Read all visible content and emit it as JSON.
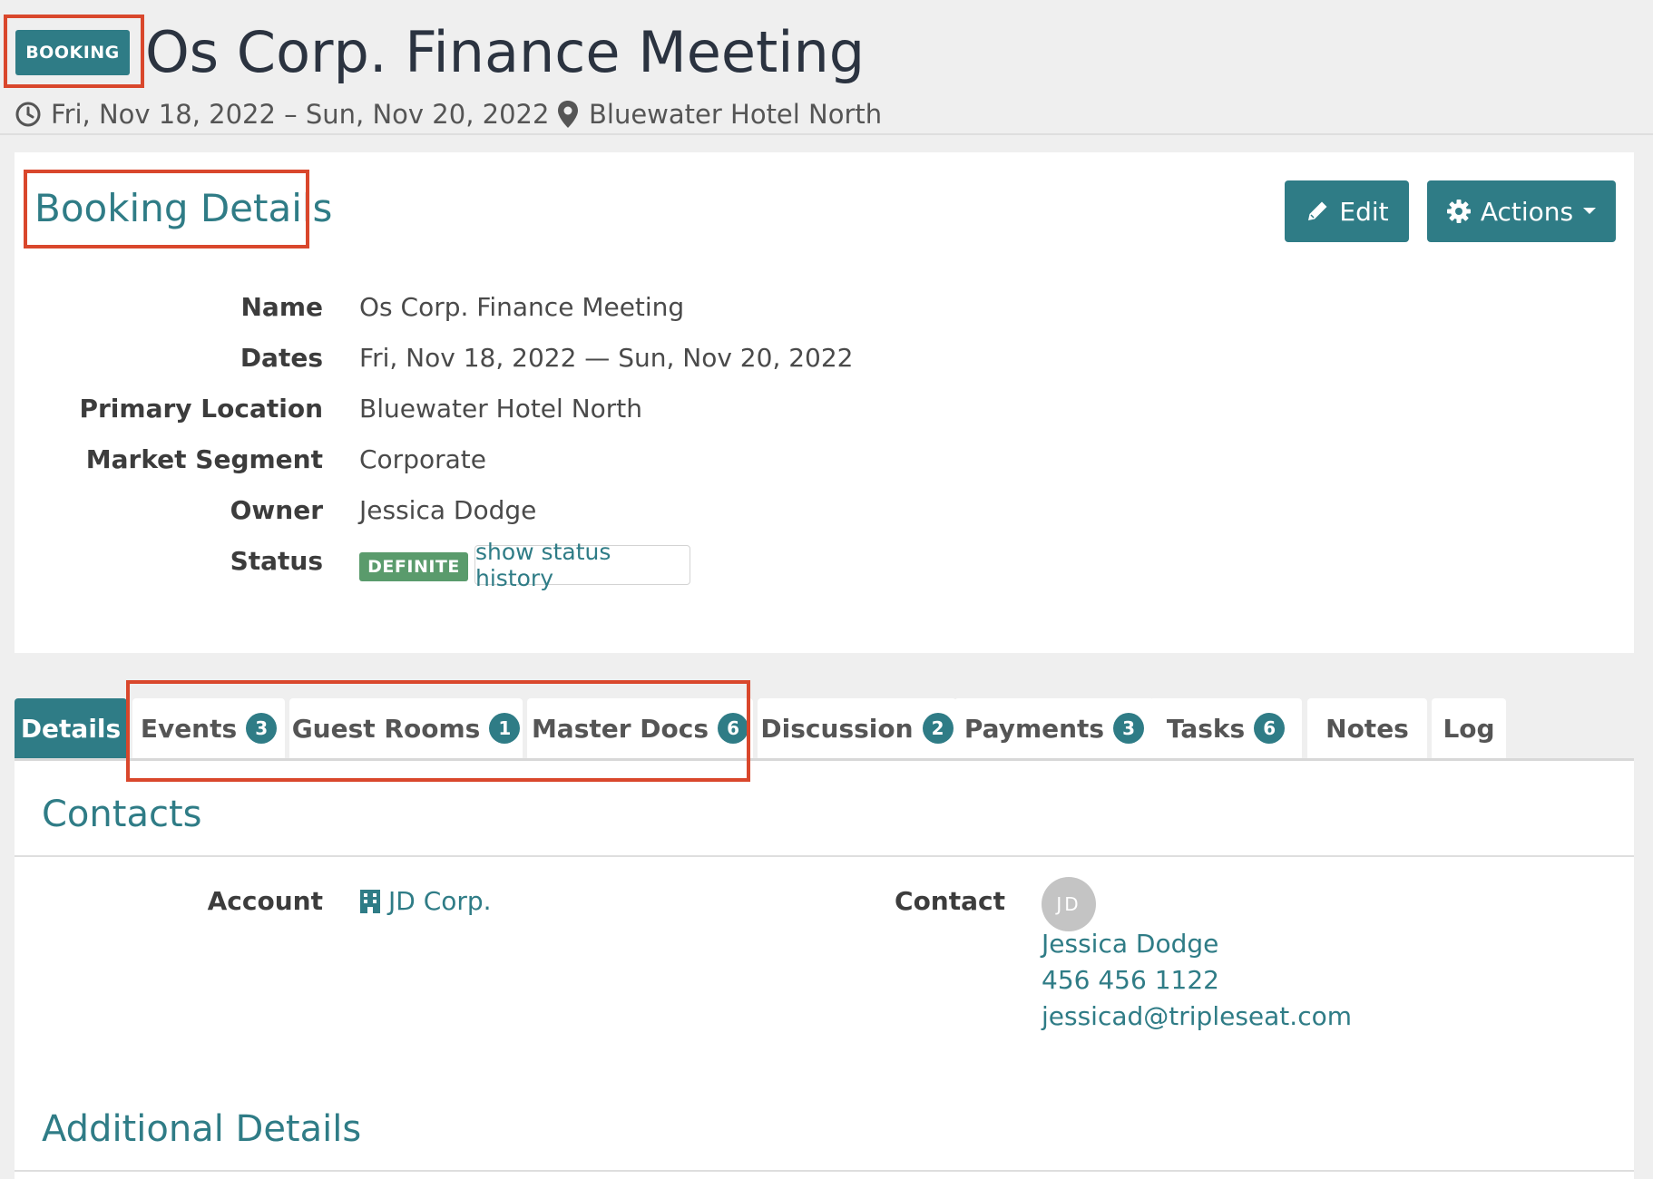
{
  "header": {
    "badge": "BOOKING",
    "title": "Os Corp. Finance Meeting",
    "dates": "Fri, Nov 18, 2022 – Sun, Nov 20, 2022",
    "location": "Bluewater Hotel North"
  },
  "booking_details": {
    "title": "Booking Details",
    "edit_label": "Edit",
    "actions_label": "Actions",
    "fields": [
      {
        "label": "Name",
        "value": "Os Corp. Finance Meeting"
      },
      {
        "label": "Dates",
        "value": "Fri, Nov 18, 2022 — Sun, Nov 20, 2022"
      },
      {
        "label": "Primary Location",
        "value": "Bluewater Hotel North"
      },
      {
        "label": "Market Segment",
        "value": "Corporate"
      },
      {
        "label": "Owner",
        "value": "Jessica Dodge"
      },
      {
        "label": "Status",
        "value": ""
      }
    ],
    "status_badge": "DEFINITE",
    "status_history_link": "show status history"
  },
  "tabs": [
    {
      "label": "Details",
      "count": null,
      "active": true
    },
    {
      "label": "Events",
      "count": "3"
    },
    {
      "label": "Guest Rooms",
      "count": "1"
    },
    {
      "label": "Master Docs",
      "count": "6"
    },
    {
      "label": "Discussion",
      "count": "2"
    },
    {
      "label": "Payments",
      "count": "3"
    },
    {
      "label": "Tasks",
      "count": "6"
    },
    {
      "label": "Notes",
      "count": null
    },
    {
      "label": "Log",
      "count": null
    }
  ],
  "contacts": {
    "title": "Contacts",
    "account_label": "Account",
    "account_value": "JD Corp.",
    "contact_label": "Contact",
    "avatar_initials": "JD",
    "contact_name": "Jessica Dodge",
    "contact_phone": "456 456 1122",
    "contact_email": "jessicad@tripleseat.com"
  },
  "additional": {
    "title": "Additional Details"
  },
  "colors": {
    "accent": "#2f7c86",
    "status_definite": "#5a9b6c",
    "highlight": "#d9472c"
  },
  "icons": [
    "clock-icon",
    "map-pin-icon",
    "pencil-icon",
    "gear-icon",
    "caret-down-icon",
    "building-icon"
  ]
}
